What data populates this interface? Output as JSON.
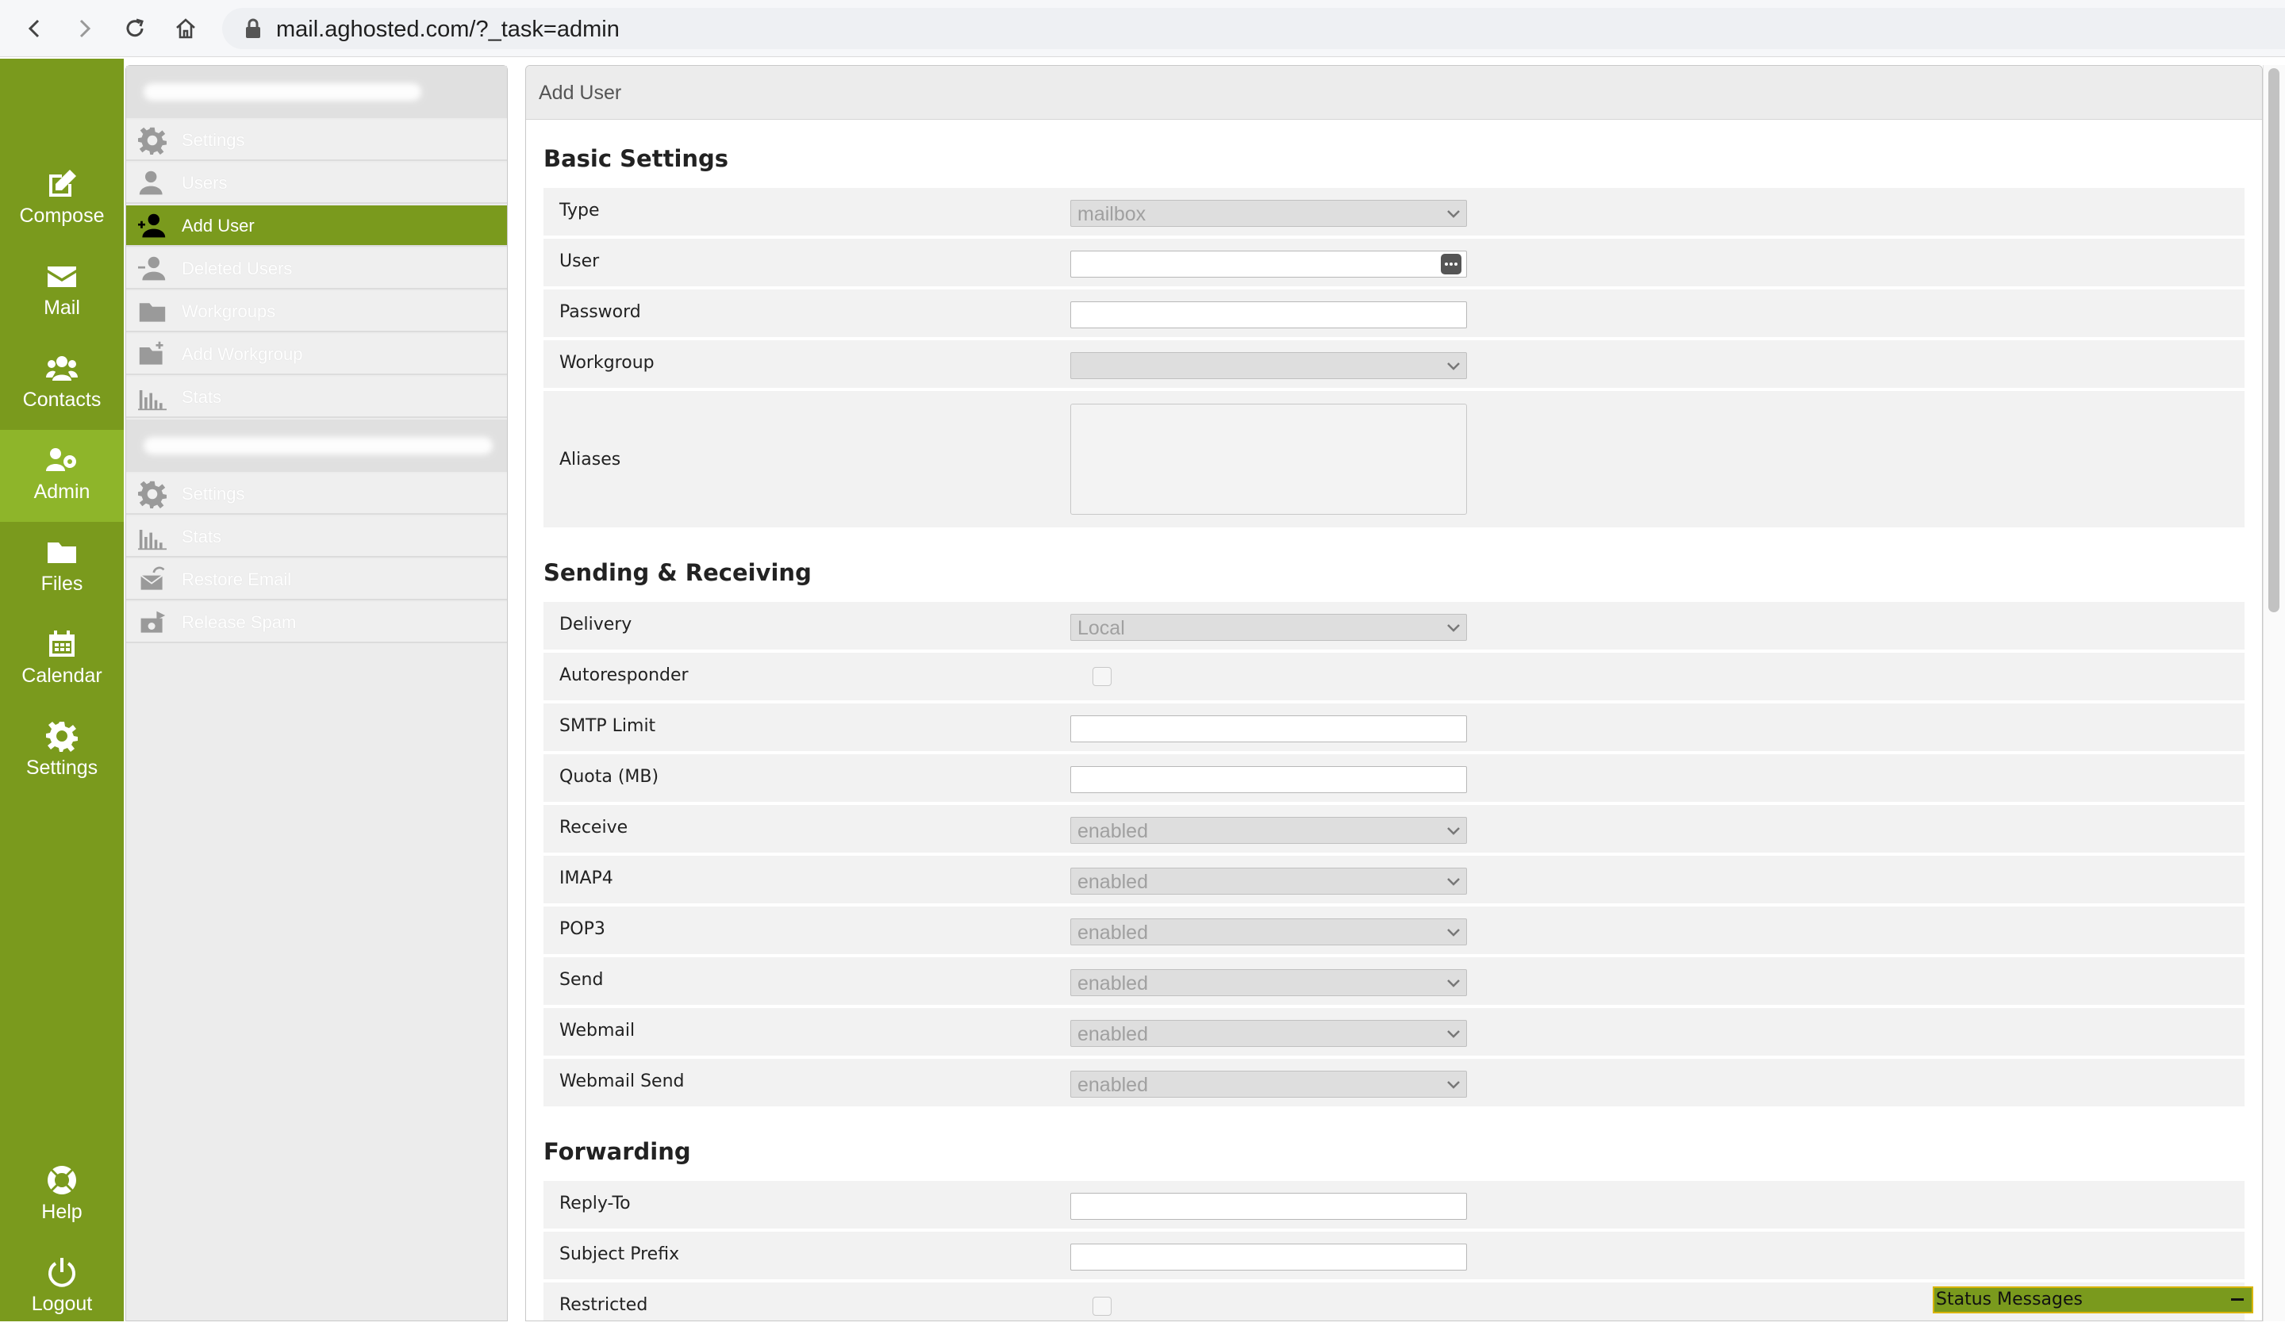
{
  "browser": {
    "url": "mail.aghosted.com/?_task=admin"
  },
  "taskbar": {
    "items": [
      {
        "label": "Compose",
        "icon": "compose-icon"
      },
      {
        "label": "Mail",
        "icon": "envelope-icon"
      },
      {
        "label": "Contacts",
        "icon": "contacts-icon"
      },
      {
        "label": "Admin",
        "icon": "admin-icon",
        "active": true
      },
      {
        "label": "Files",
        "icon": "folder-icon"
      },
      {
        "label": "Calendar",
        "icon": "calendar-icon"
      },
      {
        "label": "Settings",
        "icon": "gear-icon"
      }
    ],
    "bottom": [
      {
        "label": "Help",
        "icon": "lifebuoy-icon"
      },
      {
        "label": "Logout",
        "icon": "power-icon"
      }
    ]
  },
  "sidebar": {
    "group1": [
      {
        "label": "Settings",
        "icon": "gear-icon"
      },
      {
        "label": "Users",
        "icon": "user-icon"
      },
      {
        "label": "Add User",
        "icon": "add-user-icon",
        "selected": true
      },
      {
        "label": "Deleted Users",
        "icon": "deleted-users-icon"
      },
      {
        "label": "Workgroups",
        "icon": "folder-icon"
      },
      {
        "label": "Add Workgroup",
        "icon": "add-folder-icon"
      },
      {
        "label": "Stats",
        "icon": "stats-icon"
      }
    ],
    "group2": [
      {
        "label": "Settings",
        "icon": "gear-icon"
      },
      {
        "label": "Stats",
        "icon": "stats-icon"
      },
      {
        "label": "Restore Email",
        "icon": "restore-email-icon"
      },
      {
        "label": "Release Spam",
        "icon": "release-spam-icon"
      }
    ]
  },
  "main": {
    "title": "Add User",
    "sections": {
      "basic": "Basic Settings",
      "sending": "Sending & Receiving",
      "forwarding": "Forwarding"
    },
    "fields": {
      "type": {
        "label": "Type",
        "value": "mailbox"
      },
      "user": {
        "label": "User",
        "value": ""
      },
      "password": {
        "label": "Password",
        "value": ""
      },
      "workgroup": {
        "label": "Workgroup",
        "value": ""
      },
      "aliases": {
        "label": "Aliases",
        "value": ""
      },
      "delivery": {
        "label": "Delivery",
        "value": "Local"
      },
      "autoresponder": {
        "label": "Autoresponder",
        "checked": false
      },
      "smtp_limit": {
        "label": "SMTP Limit",
        "value": ""
      },
      "quota": {
        "label": "Quota (MB)",
        "value": ""
      },
      "receive": {
        "label": "Receive",
        "value": "enabled"
      },
      "imap4": {
        "label": "IMAP4",
        "value": "enabled"
      },
      "pop3": {
        "label": "POP3",
        "value": "enabled"
      },
      "send": {
        "label": "Send",
        "value": "enabled"
      },
      "webmail": {
        "label": "Webmail",
        "value": "enabled"
      },
      "webmail_send": {
        "label": "Webmail Send",
        "value": "enabled"
      },
      "reply_to": {
        "label": "Reply-To",
        "value": ""
      },
      "subject_prefix": {
        "label": "Subject Prefix",
        "value": ""
      },
      "restricted": {
        "label": "Restricted",
        "checked": false
      }
    }
  },
  "status": {
    "label": "Status Messages"
  }
}
